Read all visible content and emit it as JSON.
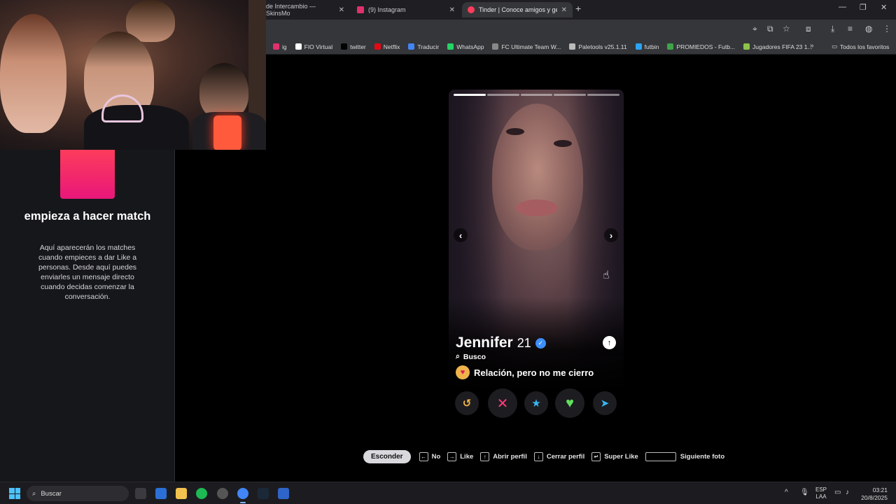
{
  "browser": {
    "tabs": [
      {
        "title": "de Intercambio — SkinsMo",
        "color": "#6b6b72",
        "active": false
      },
      {
        "title": "(9) Instagram",
        "color": "#e1306c",
        "active": false
      },
      {
        "title": "Tinder | Conoce amigos y gente",
        "color": "#fd3c5c",
        "active": true
      }
    ],
    "new_tab": "+",
    "win_min": "—",
    "win_max": "❐",
    "win_close": "✕",
    "tab_close": "✕"
  },
  "bookmarks": [
    {
      "label": "ig",
      "color": "#e1306c"
    },
    {
      "label": "FIO Virtual",
      "color": "#ffffff"
    },
    {
      "label": "twitter",
      "color": "#000000"
    },
    {
      "label": "Netflix",
      "color": "#e50914"
    },
    {
      "label": "Traducir",
      "color": "#4285f4"
    },
    {
      "label": "WhatsApp",
      "color": "#25d366"
    },
    {
      "label": "FC Ultimate Team W...",
      "color": "#888888"
    },
    {
      "label": "Paletools v25.1.11",
      "color": "#bbbbbb"
    },
    {
      "label": "futbin",
      "color": "#2aa4f4"
    },
    {
      "label": "PROMIEDOS - Futb...",
      "color": "#3ea34a"
    },
    {
      "label": "Jugadores FIFA 23 1...",
      "color": "#8bc34a"
    }
  ],
  "bookmarks_more": "»",
  "bookmarks_all": "Todos los favoritos",
  "sidebar": {
    "title": "empieza a hacer match",
    "description": "Aquí aparecerán los matches cuando empieces a dar Like a personas. Desde aquí puedes enviarles un mensaje directo cuando decidas comenzar la conversación."
  },
  "profile": {
    "name": "Jennifer",
    "age": "21",
    "verified_icon": "✓",
    "looking_label": "Busco",
    "relationship": "Relación, pero no me cierro",
    "photo_count": 5,
    "photo_index": 0,
    "info_icon": "↑",
    "prev_icon": "‹",
    "next_icon": "›"
  },
  "actions": [
    {
      "name": "rewind",
      "glyph": "↺",
      "color": "#f5b748",
      "size": "sm"
    },
    {
      "name": "nope",
      "glyph": "✕",
      "color": "#ff3a7a",
      "size": "lg"
    },
    {
      "name": "super-like",
      "glyph": "★",
      "color": "#3ab7f5",
      "size": "sm"
    },
    {
      "name": "like",
      "glyph": "♥",
      "color": "#5fe05c",
      "size": "lg"
    },
    {
      "name": "boost",
      "glyph": "➤",
      "color": "#3ab7f5",
      "size": "sm"
    }
  ],
  "hints": {
    "hide_button": "Esconder",
    "items": [
      {
        "key": "←",
        "label": "No"
      },
      {
        "key": "→",
        "label": "Like"
      },
      {
        "key": "↑",
        "label": "Abrir perfil"
      },
      {
        "key": "↓",
        "label": "Cerrar perfil"
      },
      {
        "key": "↵",
        "label": "Super Like"
      }
    ],
    "next_photo": "Siguiente foto"
  },
  "taskbar": {
    "search_placeholder": "Buscar",
    "lang_top": "ESP",
    "lang_bottom": "LAA",
    "time": "03:21",
    "date": "20/8/2025",
    "tray_up": "^"
  }
}
